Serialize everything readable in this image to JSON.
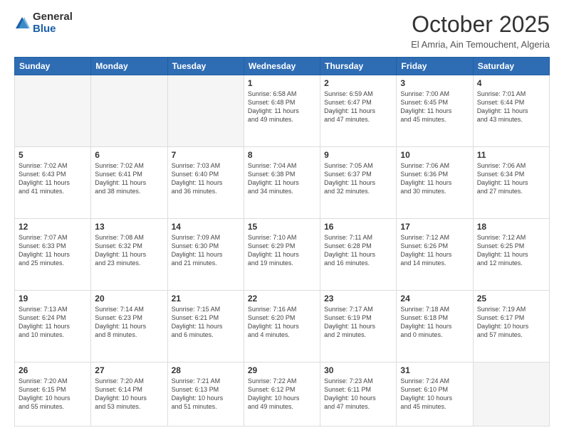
{
  "header": {
    "logo_general": "General",
    "logo_blue": "Blue",
    "month_title": "October 2025",
    "location": "El Amria, Ain Temouchent, Algeria"
  },
  "days_of_week": [
    "Sunday",
    "Monday",
    "Tuesday",
    "Wednesday",
    "Thursday",
    "Friday",
    "Saturday"
  ],
  "weeks": [
    [
      {
        "day": "",
        "info": ""
      },
      {
        "day": "",
        "info": ""
      },
      {
        "day": "",
        "info": ""
      },
      {
        "day": "1",
        "info": "Sunrise: 6:58 AM\nSunset: 6:48 PM\nDaylight: 11 hours\nand 49 minutes."
      },
      {
        "day": "2",
        "info": "Sunrise: 6:59 AM\nSunset: 6:47 PM\nDaylight: 11 hours\nand 47 minutes."
      },
      {
        "day": "3",
        "info": "Sunrise: 7:00 AM\nSunset: 6:45 PM\nDaylight: 11 hours\nand 45 minutes."
      },
      {
        "day": "4",
        "info": "Sunrise: 7:01 AM\nSunset: 6:44 PM\nDaylight: 11 hours\nand 43 minutes."
      }
    ],
    [
      {
        "day": "5",
        "info": "Sunrise: 7:02 AM\nSunset: 6:43 PM\nDaylight: 11 hours\nand 41 minutes."
      },
      {
        "day": "6",
        "info": "Sunrise: 7:02 AM\nSunset: 6:41 PM\nDaylight: 11 hours\nand 38 minutes."
      },
      {
        "day": "7",
        "info": "Sunrise: 7:03 AM\nSunset: 6:40 PM\nDaylight: 11 hours\nand 36 minutes."
      },
      {
        "day": "8",
        "info": "Sunrise: 7:04 AM\nSunset: 6:38 PM\nDaylight: 11 hours\nand 34 minutes."
      },
      {
        "day": "9",
        "info": "Sunrise: 7:05 AM\nSunset: 6:37 PM\nDaylight: 11 hours\nand 32 minutes."
      },
      {
        "day": "10",
        "info": "Sunrise: 7:06 AM\nSunset: 6:36 PM\nDaylight: 11 hours\nand 30 minutes."
      },
      {
        "day": "11",
        "info": "Sunrise: 7:06 AM\nSunset: 6:34 PM\nDaylight: 11 hours\nand 27 minutes."
      }
    ],
    [
      {
        "day": "12",
        "info": "Sunrise: 7:07 AM\nSunset: 6:33 PM\nDaylight: 11 hours\nand 25 minutes."
      },
      {
        "day": "13",
        "info": "Sunrise: 7:08 AM\nSunset: 6:32 PM\nDaylight: 11 hours\nand 23 minutes."
      },
      {
        "day": "14",
        "info": "Sunrise: 7:09 AM\nSunset: 6:30 PM\nDaylight: 11 hours\nand 21 minutes."
      },
      {
        "day": "15",
        "info": "Sunrise: 7:10 AM\nSunset: 6:29 PM\nDaylight: 11 hours\nand 19 minutes."
      },
      {
        "day": "16",
        "info": "Sunrise: 7:11 AM\nSunset: 6:28 PM\nDaylight: 11 hours\nand 16 minutes."
      },
      {
        "day": "17",
        "info": "Sunrise: 7:12 AM\nSunset: 6:26 PM\nDaylight: 11 hours\nand 14 minutes."
      },
      {
        "day": "18",
        "info": "Sunrise: 7:12 AM\nSunset: 6:25 PM\nDaylight: 11 hours\nand 12 minutes."
      }
    ],
    [
      {
        "day": "19",
        "info": "Sunrise: 7:13 AM\nSunset: 6:24 PM\nDaylight: 11 hours\nand 10 minutes."
      },
      {
        "day": "20",
        "info": "Sunrise: 7:14 AM\nSunset: 6:23 PM\nDaylight: 11 hours\nand 8 minutes."
      },
      {
        "day": "21",
        "info": "Sunrise: 7:15 AM\nSunset: 6:21 PM\nDaylight: 11 hours\nand 6 minutes."
      },
      {
        "day": "22",
        "info": "Sunrise: 7:16 AM\nSunset: 6:20 PM\nDaylight: 11 hours\nand 4 minutes."
      },
      {
        "day": "23",
        "info": "Sunrise: 7:17 AM\nSunset: 6:19 PM\nDaylight: 11 hours\nand 2 minutes."
      },
      {
        "day": "24",
        "info": "Sunrise: 7:18 AM\nSunset: 6:18 PM\nDaylight: 11 hours\nand 0 minutes."
      },
      {
        "day": "25",
        "info": "Sunrise: 7:19 AM\nSunset: 6:17 PM\nDaylight: 10 hours\nand 57 minutes."
      }
    ],
    [
      {
        "day": "26",
        "info": "Sunrise: 7:20 AM\nSunset: 6:15 PM\nDaylight: 10 hours\nand 55 minutes."
      },
      {
        "day": "27",
        "info": "Sunrise: 7:20 AM\nSunset: 6:14 PM\nDaylight: 10 hours\nand 53 minutes."
      },
      {
        "day": "28",
        "info": "Sunrise: 7:21 AM\nSunset: 6:13 PM\nDaylight: 10 hours\nand 51 minutes."
      },
      {
        "day": "29",
        "info": "Sunrise: 7:22 AM\nSunset: 6:12 PM\nDaylight: 10 hours\nand 49 minutes."
      },
      {
        "day": "30",
        "info": "Sunrise: 7:23 AM\nSunset: 6:11 PM\nDaylight: 10 hours\nand 47 minutes."
      },
      {
        "day": "31",
        "info": "Sunrise: 7:24 AM\nSunset: 6:10 PM\nDaylight: 10 hours\nand 45 minutes."
      },
      {
        "day": "",
        "info": ""
      }
    ]
  ]
}
